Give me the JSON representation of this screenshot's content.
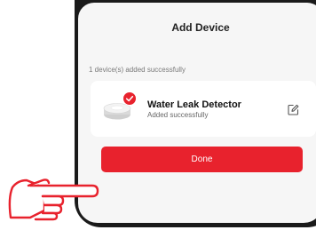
{
  "dialog": {
    "title": "Add Device",
    "subtitle": "1 device(s) added successfully"
  },
  "device": {
    "name": "Water Leak Detector",
    "status": "Added successfully",
    "icon": "water-leak-detector-icon"
  },
  "actions": {
    "done_label": "Done"
  },
  "colors": {
    "accent": "#e8222d",
    "card_background": "#ffffff",
    "screen_background": "#f6f6f6",
    "frame": "#1a1a1a"
  }
}
